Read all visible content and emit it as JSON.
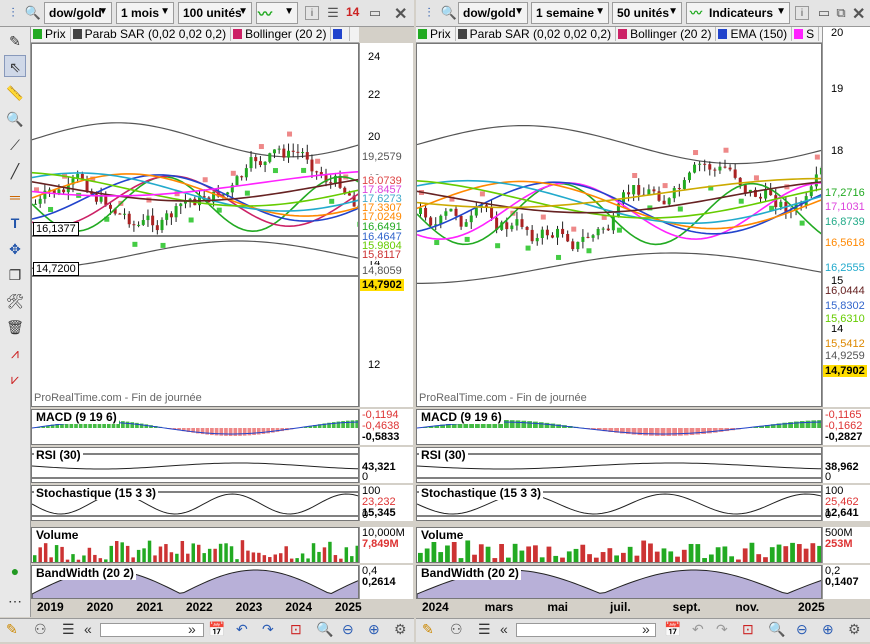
{
  "left": {
    "toolbar": {
      "instrument": "dow/gold",
      "period": "1 mois",
      "units": "100 unités",
      "badge": "14"
    },
    "legend": [
      {
        "label": "Prix",
        "color": "#22aa22"
      },
      {
        "label": "Parab SAR (0,02 0,02 0,2)",
        "color": "#444444"
      },
      {
        "label": "Bollinger (20 2)",
        "color": "#cc2266"
      },
      {
        "label": "",
        "color": "#2244cc"
      }
    ],
    "price_ticks": [
      "24",
      "22",
      "20",
      "18",
      "16",
      "14",
      "12"
    ],
    "price_labels": [
      {
        "v": "19,2579",
        "bg": "#ffffff",
        "c": "#555555"
      },
      {
        "v": "18,0739",
        "bg": "#ffffff",
        "c": "#dd4444"
      },
      {
        "v": "17,8457",
        "bg": "#ffffff",
        "c": "#dd44dd"
      },
      {
        "v": "17,6273",
        "bg": "#ffffff",
        "c": "#44aacc"
      },
      {
        "v": "17,3307",
        "bg": "#ffffff",
        "c": "#ff8800"
      },
      {
        "v": "17,0249",
        "bg": "#ffffff",
        "c": "#ff8800"
      },
      {
        "v": "16,6491",
        "bg": "#ffffff",
        "c": "#22aa22"
      },
      {
        "v": "16,4647",
        "bg": "#ffffff",
        "c": "#3366cc"
      },
      {
        "v": "15,9804",
        "bg": "#ffffff",
        "c": "#66cc00"
      },
      {
        "v": "15,8117",
        "bg": "#ffffff",
        "c": "#cc3333"
      },
      {
        "v": "14,8059",
        "bg": "#ffffff",
        "c": "#555555"
      },
      {
        "v": "14,7902",
        "bg": "#ffdd00",
        "c": "#000000"
      }
    ],
    "hlines": [
      "16,1377",
      "14,7200"
    ],
    "copyright": "ProRealTime.com - Fin de journée",
    "indicators": {
      "macd": {
        "title": "MACD (9 19 6)",
        "values": [
          "-0,1194",
          "-0,4638",
          "-0,5833"
        ]
      },
      "rsi": {
        "title": "RSI (30)",
        "values": [
          "43,321"
        ]
      },
      "stoch": {
        "title": "Stochastique (15 3 3)",
        "values": [
          "100",
          "23,232",
          "15,345"
        ]
      },
      "volume": {
        "title": "Volume",
        "values": [
          "10,000M",
          "7,849M"
        ]
      },
      "bandwidth": {
        "title": "BandWidth (20 2)",
        "values": [
          "0,4",
          "0,2614"
        ]
      }
    },
    "dates": [
      "2019",
      "2020",
      "2021",
      "2022",
      "2023",
      "2024",
      "2025"
    ]
  },
  "right": {
    "toolbar": {
      "instrument": "dow/gold",
      "period": "1 semaine",
      "units": "50 unités",
      "indicators": "Indicateurs"
    },
    "legend": [
      {
        "label": "Prix",
        "color": "#22aa22"
      },
      {
        "label": "Parab SAR (0,02 0,02 0,2)",
        "color": "#444444"
      },
      {
        "label": "Bollinger (20 2)",
        "color": "#cc2266"
      },
      {
        "label": "EMA (150)",
        "color": "#2244cc"
      },
      {
        "label": "S",
        "color": "#ff22ff"
      }
    ],
    "price_ticks": [
      "20",
      "19",
      "18",
      "15",
      "14"
    ],
    "price_labels": [
      {
        "v": "17,2716",
        "c": "#22aa22"
      },
      {
        "v": "17,1031",
        "c": "#dd44dd"
      },
      {
        "v": "16,8739",
        "c": "#22aa88"
      },
      {
        "v": "16,5618",
        "c": "#ff8800"
      },
      {
        "v": "16,2555",
        "c": "#22aacc"
      },
      {
        "v": "16,0444",
        "c": "#662222"
      },
      {
        "v": "15,8302",
        "c": "#3366cc"
      },
      {
        "v": "15,6310",
        "c": "#66cc00"
      },
      {
        "v": "15,5412",
        "c": "#dd8800"
      },
      {
        "v": "14,9259",
        "c": "#555555"
      },
      {
        "v": "14,7902",
        "c": "#000000"
      }
    ],
    "copyright": "ProRealTime.com - Fin de journée",
    "indicators": {
      "macd": {
        "title": "MACD (9 19 6)",
        "values": [
          "-0,1165",
          "-0,1662",
          "-0,2827"
        ]
      },
      "rsi": {
        "title": "RSI (30)",
        "values": [
          "38,962"
        ]
      },
      "stoch": {
        "title": "Stochastique (15 3 3)",
        "values": [
          "100",
          "25,462",
          "12,641"
        ]
      },
      "volume": {
        "title": "Volume",
        "values": [
          "500M",
          "253M"
        ]
      },
      "bandwidth": {
        "title": "BandWidth (20 2)",
        "values": [
          "0,2",
          "0,1407"
        ]
      }
    },
    "dates": [
      "2024",
      "mars",
      "mai",
      "juil.",
      "sept.",
      "nov.",
      "2025"
    ]
  },
  "indicator_zero": "0"
}
